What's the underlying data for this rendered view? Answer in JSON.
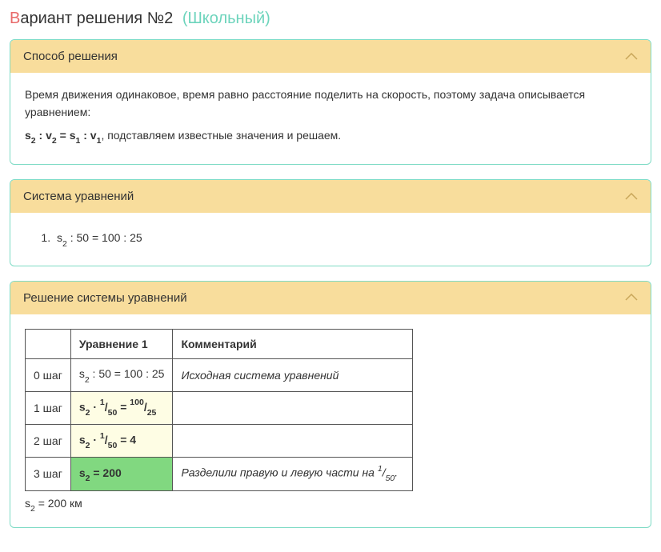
{
  "title": {
    "first_letter": "В",
    "rest": "ариант решения №2",
    "level": "(Школьный)"
  },
  "panels": {
    "method": {
      "header": "Способ решения",
      "text1": "Время движения одинаковое, время равно расстояние поделить на скорость, поэтому задача описывается уравнением:",
      "text2_suffix": ", подставляем известные значения и решаем."
    },
    "system": {
      "header": "Система уравнений",
      "eq1_suffix": " : 50 = 100 : 25"
    },
    "solution": {
      "header": "Решение системы уравнений",
      "col_eq": "Уравнение 1",
      "col_comment": "Комментарий",
      "step0_label": "0 шаг",
      "step0_eq_suffix": " : 50 = 100 : 25",
      "step0_comment": "Исходная система уравнений",
      "step1_label": "1 шаг",
      "step2_label": "2 шаг",
      "step2_eq_suffix": " = 4",
      "step3_label": "3 шаг",
      "step3_eq_suffix": " = 200",
      "step3_comment_prefix": "Разделили правую и левую части на ",
      "result_suffix": " = 200 км"
    }
  },
  "math": {
    "s2": "s",
    "s2_sub": "2",
    "s1": "s",
    "s1_sub": "1",
    "v2": "v",
    "v2_sub": "2",
    "v1": "v",
    "v1_sub": "1",
    "dot_mid": " · ",
    "frac_1_50_num": "1",
    "frac_1_50_den": "50",
    "frac_100_25_num": "100",
    "frac_100_25_den": "25",
    "eq_sign": " = ",
    "colon": " : ",
    "period": "."
  }
}
